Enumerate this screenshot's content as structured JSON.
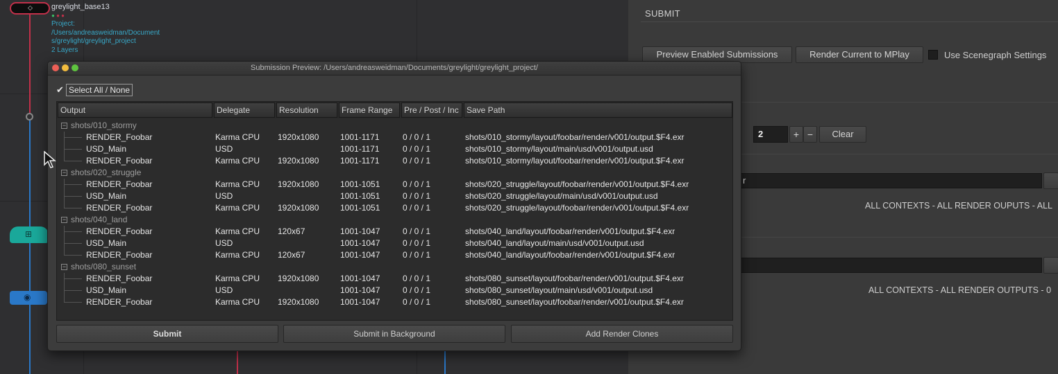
{
  "network": {
    "node_name": "greylight_base13",
    "project_label": "Project:",
    "project_path_line1": "/Users/andreasweidman/Document",
    "project_path_line2": "s/greylight/greylight_project",
    "layers": "2 Layers"
  },
  "panel": {
    "heading": "SUBMIT",
    "preview_button": "Preview Enabled Submissions",
    "render_button": "Render Current to MPlay",
    "scenegraph_label": "Use Scenegraph Settings",
    "counter_value": "2",
    "plus": "+",
    "minus": "−",
    "clear_button": "Clear",
    "field1_text": "r",
    "contexts_line1": "ALL CONTEXTS  -  ALL RENDER OUPUTS  -  ALL",
    "contexts_line2": "ALL CONTEXTS  -  ALL RENDER OUTPUTS  -  0"
  },
  "dialog": {
    "title": "Submission Preview: /Users/andreasweidman/Documents/greylight/greylight_project/",
    "select_all": "Select All / None",
    "columns": [
      "Output",
      "Delegate",
      "Resolution",
      "Frame Range",
      "Pre / Post / Inc",
      "Save Path"
    ],
    "groups": [
      {
        "name": "shots/010_stormy",
        "rows": [
          {
            "output": "RENDER_Foobar",
            "delegate": "Karma CPU",
            "resolution": "1920x1080",
            "frames": "1001-1171",
            "ppi": "0 / 0 / 1",
            "path": "shots/010_stormy/layout/foobar/render/v001/output.$F4.exr"
          },
          {
            "output": "USD_Main",
            "delegate": "USD",
            "resolution": "",
            "frames": "1001-1171",
            "ppi": "0 / 0 / 1",
            "path": "shots/010_stormy/layout/main/usd/v001/output.usd"
          },
          {
            "output": "RENDER_Foobar",
            "delegate": "Karma CPU",
            "resolution": "1920x1080",
            "frames": "1001-1171",
            "ppi": "0 / 0 / 1",
            "path": "shots/010_stormy/layout/foobar/render/v001/output.$F4.exr"
          }
        ]
      },
      {
        "name": "shots/020_struggle",
        "rows": [
          {
            "output": "RENDER_Foobar",
            "delegate": "Karma CPU",
            "resolution": "1920x1080",
            "frames": "1001-1051",
            "ppi": "0 / 0 / 1",
            "path": "shots/020_struggle/layout/foobar/render/v001/output.$F4.exr"
          },
          {
            "output": "USD_Main",
            "delegate": "USD",
            "resolution": "",
            "frames": "1001-1051",
            "ppi": "0 / 0 / 1",
            "path": "shots/020_struggle/layout/main/usd/v001/output.usd"
          },
          {
            "output": "RENDER_Foobar",
            "delegate": "Karma CPU",
            "resolution": "1920x1080",
            "frames": "1001-1051",
            "ppi": "0 / 0 / 1",
            "path": "shots/020_struggle/layout/foobar/render/v001/output.$F4.exr"
          }
        ]
      },
      {
        "name": "shots/040_land",
        "rows": [
          {
            "output": "RENDER_Foobar",
            "delegate": "Karma CPU",
            "resolution": "120x67",
            "frames": "1001-1047",
            "ppi": "0 / 0 / 1",
            "path": "shots/040_land/layout/foobar/render/v001/output.$F4.exr"
          },
          {
            "output": "USD_Main",
            "delegate": "USD",
            "resolution": "",
            "frames": "1001-1047",
            "ppi": "0 / 0 / 1",
            "path": "shots/040_land/layout/main/usd/v001/output.usd"
          },
          {
            "output": "RENDER_Foobar",
            "delegate": "Karma CPU",
            "resolution": "120x67",
            "frames": "1001-1047",
            "ppi": "0 / 0 / 1",
            "path": "shots/040_land/layout/foobar/render/v001/output.$F4.exr"
          }
        ]
      },
      {
        "name": "shots/080_sunset",
        "rows": [
          {
            "output": "RENDER_Foobar",
            "delegate": "Karma CPU",
            "resolution": "1920x1080",
            "frames": "1001-1047",
            "ppi": "0 / 0 / 1",
            "path": "shots/080_sunset/layout/foobar/render/v001/output.$F4.exr"
          },
          {
            "output": "USD_Main",
            "delegate": "USD",
            "resolution": "",
            "frames": "1001-1047",
            "ppi": "0 / 0 / 1",
            "path": "shots/080_sunset/layout/main/usd/v001/output.usd"
          },
          {
            "output": "RENDER_Foobar",
            "delegate": "Karma CPU",
            "resolution": "1920x1080",
            "frames": "1001-1047",
            "ppi": "0 / 0 / 1",
            "path": "shots/080_sunset/layout/foobar/render/v001/output.$F4.exr"
          }
        ]
      }
    ],
    "buttons": {
      "submit": "Submit",
      "submit_bg": "Submit in Background",
      "add_clones": "Add Render Clones"
    }
  },
  "colors": {
    "accent_teal": "#1aa89a",
    "wire_red": "#c2304a",
    "wire_blue": "#2a78c8"
  }
}
